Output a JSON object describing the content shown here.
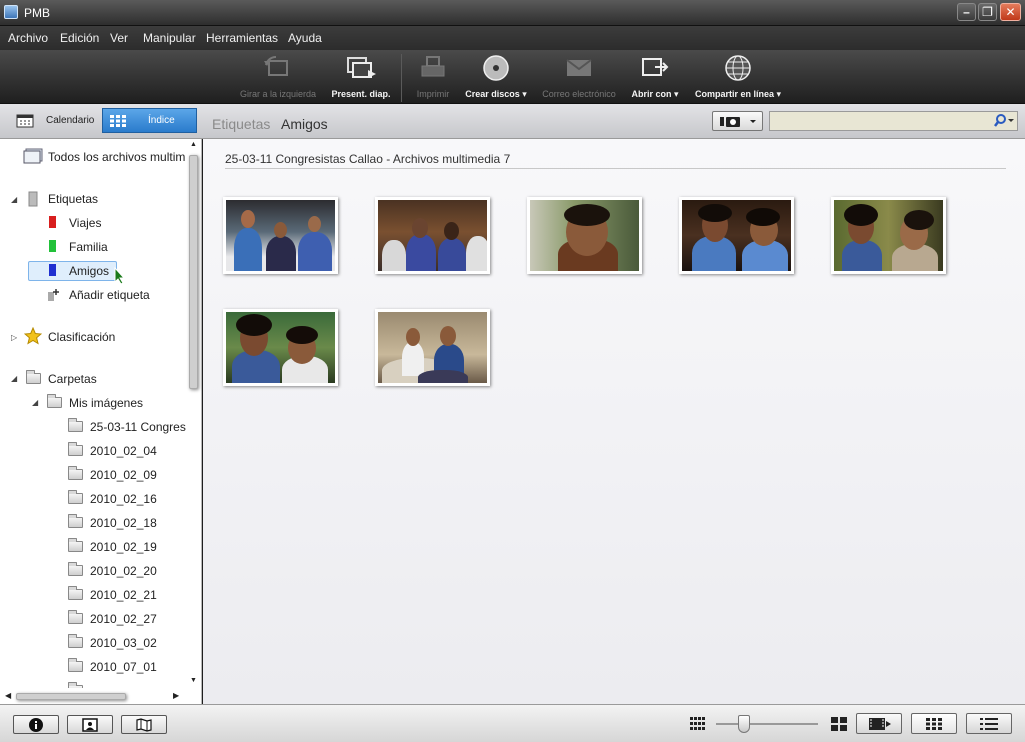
{
  "window": {
    "title": "PMB"
  },
  "menu": [
    "Archivo",
    "Edición",
    "Ver",
    "Manipular",
    "Herramientas",
    "Ayuda"
  ],
  "toolbar": [
    {
      "label": "Girar a la izquierda",
      "enabled": false,
      "icon": "rotate-left-icon"
    },
    {
      "label": "Present. diap.",
      "enabled": true,
      "icon": "slideshow-icon"
    },
    {
      "label": "Imprimir",
      "enabled": false,
      "icon": "print-icon"
    },
    {
      "label": "Crear discos",
      "enabled": true,
      "icon": "disc-icon",
      "dropdown": true
    },
    {
      "label": "Correo electrónico",
      "enabled": false,
      "icon": "mail-icon"
    },
    {
      "label": "Abrir con",
      "enabled": true,
      "icon": "open-with-icon",
      "dropdown": true
    },
    {
      "label": "Compartir en línea",
      "enabled": true,
      "icon": "globe-icon",
      "dropdown": true
    }
  ],
  "nav": {
    "calendar_label": "Calendario",
    "index_label": "Índice",
    "breadcrumb_parent": "Etiquetas",
    "breadcrumb_current": "Amigos",
    "search_value": ""
  },
  "sidebar": {
    "all_media": "Todos los archivos multim",
    "tags_header": "Etiquetas",
    "tags": [
      {
        "label": "Viajes",
        "color": "#d81e1e"
      },
      {
        "label": "Familia",
        "color": "#22c13a"
      },
      {
        "label": "Amigos",
        "color": "#1f2fd0",
        "selected": true
      }
    ],
    "add_tag": "Añadir etiqueta",
    "rating": "Clasificación",
    "folders_header": "Carpetas",
    "my_pictures": "Mis imágenes",
    "folders": [
      "25-03-11 Congres",
      "2010_02_04",
      "2010_02_09",
      "2010_02_16",
      "2010_02_18",
      "2010_02_19",
      "2010_02_20",
      "2010_02_21",
      "2010_02_27",
      "2010_03_02",
      "2010_07_01"
    ]
  },
  "main": {
    "group_header": "25-03-11 Congresistas Callao   - Archivos multimedia 7",
    "thumbnails": [
      {
        "name": "photo-1",
        "bg": "#4a5a6a"
      },
      {
        "name": "photo-2",
        "bg": "#6a4a2e"
      },
      {
        "name": "photo-3",
        "bg": "#5a6a3e"
      },
      {
        "name": "photo-4",
        "bg": "#3e2a1e"
      },
      {
        "name": "photo-5",
        "bg": "#4a5a2e"
      },
      {
        "name": "photo-6",
        "bg": "#2e5a2e"
      },
      {
        "name": "photo-7",
        "bg": "#7a6a4e"
      }
    ]
  },
  "colors": {
    "selection": "#dfeefc",
    "index_tab": "#3a8ad8"
  }
}
